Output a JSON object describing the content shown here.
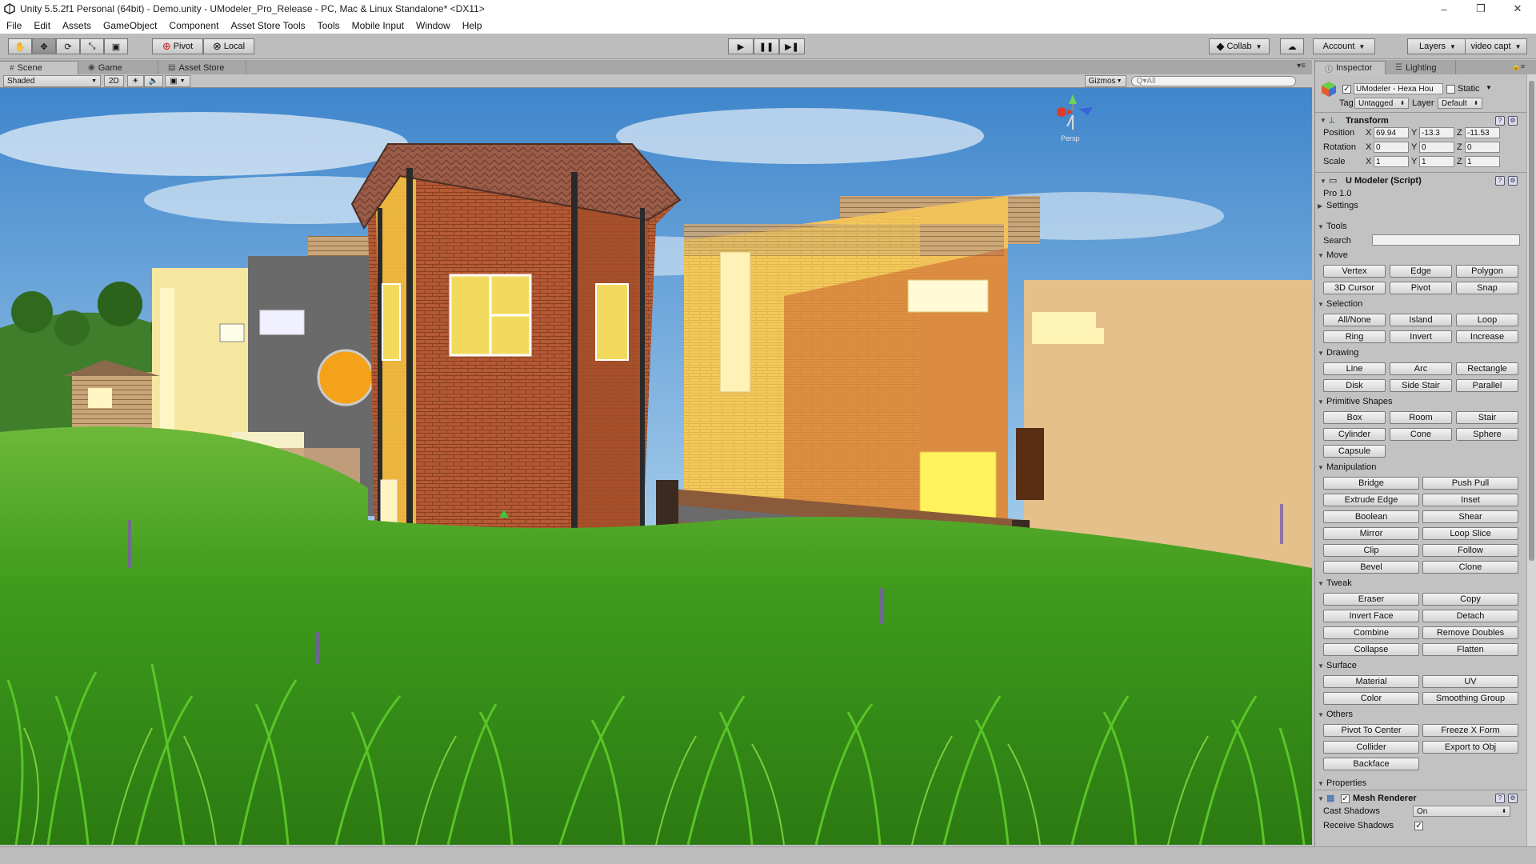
{
  "window": {
    "title": "Unity 5.5.2f1 Personal (64bit) - Demo.unity - UModeler_Pro_Release - PC, Mac & Linux Standalone* <DX11>",
    "minimize": "–",
    "maximize": "❐",
    "close": "✕"
  },
  "menu": [
    "File",
    "Edit",
    "Assets",
    "GameObject",
    "Component",
    "Asset Store Tools",
    "Tools",
    "Mobile Input",
    "Window",
    "Help"
  ],
  "toolbar": {
    "transform_tools": [
      "hand-icon",
      "move-icon",
      "rotate-icon",
      "scale-icon",
      "rect-icon"
    ],
    "pivot_label": "Pivot",
    "local_label": "Local",
    "play_icons": [
      "play-icon",
      "pause-icon",
      "step-icon"
    ],
    "collab_label": "Collab",
    "account_label": "Account",
    "layers_label": "Layers",
    "layout_label": "video capt"
  },
  "scene_tabs": [
    {
      "label": "Scene",
      "icon": "#"
    },
    {
      "label": "Game",
      "icon": "◉"
    },
    {
      "label": "Asset Store",
      "icon": "▤"
    }
  ],
  "scene_toolbar": {
    "shading": "Shaded",
    "mode_2d": "2D",
    "gizmos": "Gizmos",
    "search_placeholder": "Q▾All"
  },
  "scene": {
    "gizmo_label": "Persp",
    "colors": {
      "sky_top": "#4a8fd0",
      "sky_bottom": "#b9d7ee",
      "grass": "#3f9a1f",
      "brick": "#b25a32",
      "yellow_wall": "#f2c25a",
      "gray_wall": "#6c6c6c"
    }
  },
  "inspector": {
    "tabs": [
      {
        "label": "Inspector",
        "icon": "ⓘ"
      },
      {
        "label": "Lighting",
        "icon": "☰"
      }
    ],
    "object_name": "UModeler - Hexa Hou",
    "static_label": "Static",
    "tag_label": "Tag",
    "tag_value": "Untagged",
    "layer_label": "Layer",
    "layer_value": "Default",
    "transform": {
      "title": "Transform",
      "position_label": "Position",
      "rotation_label": "Rotation",
      "scale_label": "Scale",
      "position": {
        "x": "69.94",
        "y": "-13.3",
        "z": "-11.53"
      },
      "rotation": {
        "x": "0",
        "y": "0",
        "z": "0"
      },
      "scale": {
        "x": "1",
        "y": "1",
        "z": "1"
      }
    },
    "script": {
      "title": "U Modeler (Script)",
      "version": "Pro 1.0",
      "settings_label": "Settings",
      "tools_label": "Tools",
      "search_label": "Search",
      "properties_label": "Properties"
    },
    "sections": {
      "move": {
        "label": "Move",
        "buttons": [
          "Vertex",
          "Edge",
          "Polygon",
          "3D Cursor",
          "Pivot",
          "Snap"
        ]
      },
      "selection": {
        "label": "Selection",
        "buttons": [
          "All/None",
          "Island",
          "Loop",
          "Ring",
          "Invert",
          "Increase"
        ]
      },
      "drawing": {
        "label": "Drawing",
        "buttons": [
          "Line",
          "Arc",
          "Rectangle",
          "Disk",
          "Side Stair",
          "Parallel"
        ]
      },
      "primitive": {
        "label": "Primitive Shapes",
        "buttons": [
          "Box",
          "Room",
          "Stair",
          "Cylinder",
          "Cone",
          "Sphere",
          "Capsule"
        ]
      },
      "manipulation": {
        "label": "Manipulation",
        "buttons": [
          "Bridge",
          "Push Pull",
          "Extrude Edge",
          "Inset",
          "Boolean",
          "Shear",
          "Mirror",
          "Loop Slice",
          "Clip",
          "Follow",
          "Bevel",
          "Clone"
        ]
      },
      "tweak": {
        "label": "Tweak",
        "buttons": [
          "Eraser",
          "Copy",
          "Invert Face",
          "Detach",
          "Combine",
          "Remove Doubles",
          "Collapse",
          "Flatten"
        ]
      },
      "surface": {
        "label": "Surface",
        "buttons": [
          "Material",
          "UV",
          "Color",
          "Smoothing Group"
        ]
      },
      "others": {
        "label": "Others",
        "buttons": [
          "Pivot To Center",
          "Freeze X Form",
          "Collider",
          "Export to Obj",
          "Backface"
        ]
      }
    },
    "mesh_renderer": {
      "title": "Mesh Renderer",
      "cast_shadows_label": "Cast Shadows",
      "cast_shadows_value": "On",
      "receive_shadows_label": "Receive Shadows"
    }
  }
}
